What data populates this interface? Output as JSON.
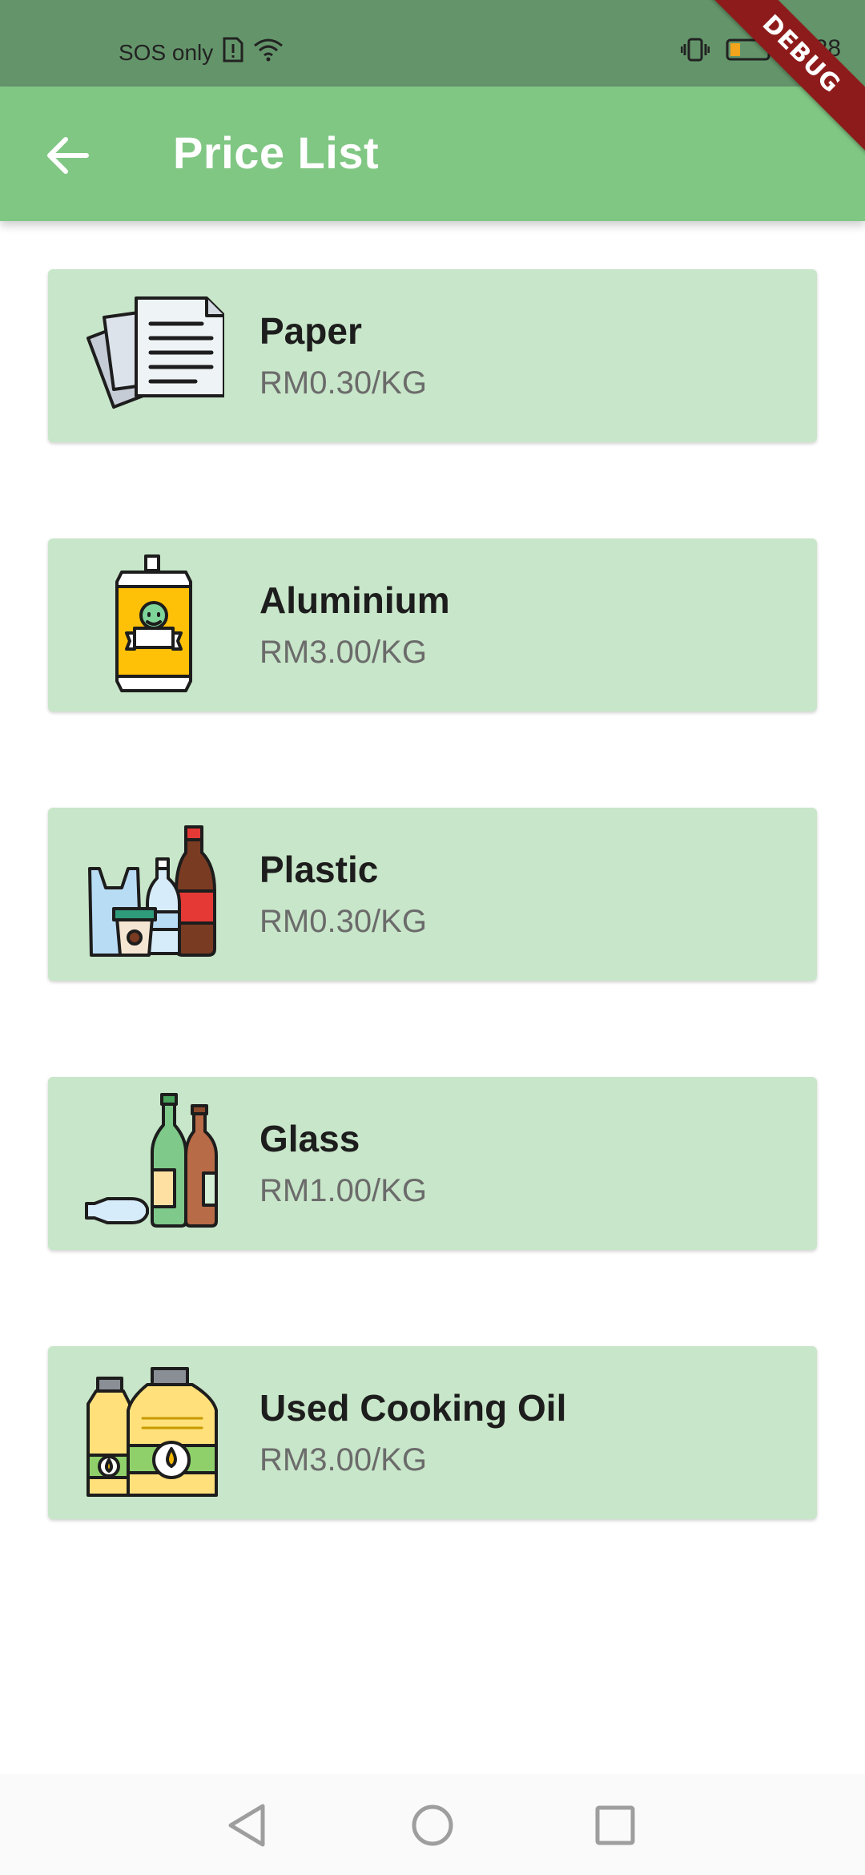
{
  "status_bar": {
    "carrier": "SOS only",
    "time": "3:28"
  },
  "debug_label": "DEBUG",
  "app_bar": {
    "title": "Price List"
  },
  "items": [
    {
      "name": "Paper",
      "price": "RM0.30/KG",
      "icon": "paper-icon"
    },
    {
      "name": "Aluminium",
      "price": "RM3.00/KG",
      "icon": "aluminium-can-icon"
    },
    {
      "name": "Plastic",
      "price": "RM0.30/KG",
      "icon": "plastic-bottles-icon"
    },
    {
      "name": "Glass",
      "price": "RM1.00/KG",
      "icon": "glass-bottles-icon"
    },
    {
      "name": "Used Cooking Oil",
      "price": "RM3.00/KG",
      "icon": "cooking-oil-icon"
    }
  ],
  "colors": {
    "status_bar": "#64956a",
    "app_bar": "#81c784",
    "card": "#c8e6c9",
    "debug_ribbon": "#8e1b1b"
  }
}
